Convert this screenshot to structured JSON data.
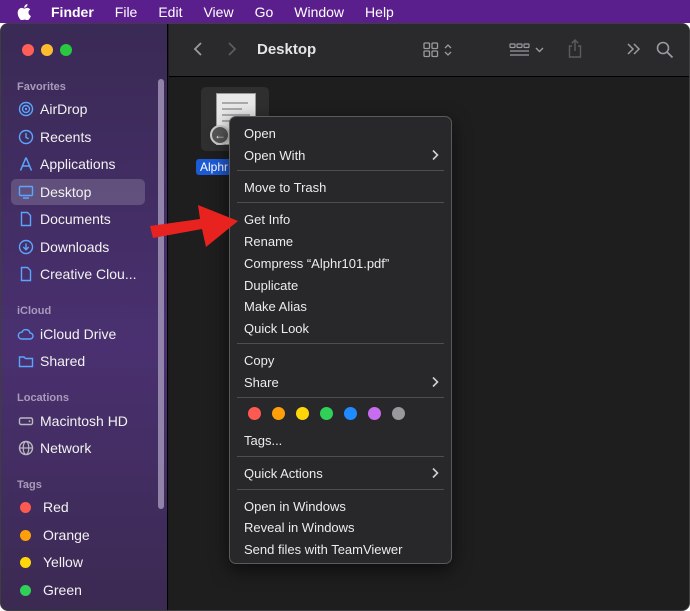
{
  "menubar": {
    "items": [
      "Finder",
      "File",
      "Edit",
      "View",
      "Go",
      "Window",
      "Help"
    ]
  },
  "window": {
    "title": "Desktop"
  },
  "sidebar": {
    "favorites_label": "Favorites",
    "favorites": [
      {
        "label": "AirDrop",
        "icon": "airdrop-icon"
      },
      {
        "label": "Recents",
        "icon": "clock-icon"
      },
      {
        "label": "Applications",
        "icon": "applications-icon"
      },
      {
        "label": "Desktop",
        "icon": "desktop-icon",
        "selected": true
      },
      {
        "label": "Documents",
        "icon": "document-icon"
      },
      {
        "label": "Downloads",
        "icon": "download-icon"
      },
      {
        "label": "Creative Clou...",
        "icon": "file-icon"
      }
    ],
    "icloud_label": "iCloud",
    "icloud": [
      {
        "label": "iCloud Drive",
        "icon": "cloud-icon"
      },
      {
        "label": "Shared",
        "icon": "shared-folder-icon"
      }
    ],
    "locations_label": "Locations",
    "locations": [
      {
        "label": "Macintosh HD",
        "icon": "disk-icon"
      },
      {
        "label": "Network",
        "icon": "globe-icon"
      }
    ],
    "tags_label": "Tags",
    "tags": [
      {
        "label": "Red",
        "color": "#ff5a52"
      },
      {
        "label": "Orange",
        "color": "#ff9f0a"
      },
      {
        "label": "Yellow",
        "color": "#ffd60a"
      },
      {
        "label": "Green",
        "color": "#30d158"
      }
    ]
  },
  "file": {
    "label": "Alphr"
  },
  "context_menu": {
    "open": "Open",
    "open_with": "Open With",
    "move_to_trash": "Move to Trash",
    "get_info": "Get Info",
    "rename": "Rename",
    "compress": "Compress “Alphr101.pdf”",
    "duplicate": "Duplicate",
    "make_alias": "Make Alias",
    "quick_look": "Quick Look",
    "copy": "Copy",
    "share": "Share",
    "tag_colors": [
      "#ff5a52",
      "#ff9f0a",
      "#ffd60a",
      "#30d158",
      "#1e8cff",
      "#c86cf0",
      "#98989d"
    ],
    "tags": "Tags...",
    "quick_actions": "Quick Actions",
    "open_in_windows": "Open in Windows",
    "reveal_in_windows": "Reveal in Windows",
    "send_teamviewer": "Send files with TeamViewer"
  },
  "colors": {
    "menubar": "#5b1f8d",
    "arrow": "#e8231f",
    "selection": "#1d5ad6"
  }
}
